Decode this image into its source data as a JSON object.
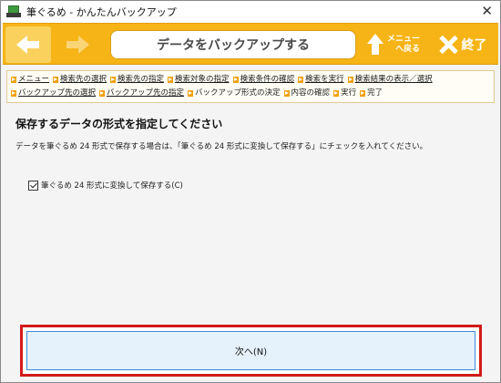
{
  "window": {
    "title": "筆ぐるめ - かんたんバックアップ"
  },
  "toolbar": {
    "page_title": "データをバックアップする",
    "menu_label_line1": "メニュー",
    "menu_label_line2": "へ戻る",
    "end_label": "終了"
  },
  "breadcrumb": [
    {
      "label": "メニュー",
      "link": true
    },
    {
      "label": "検索先の選択",
      "link": true
    },
    {
      "label": "検索先の指定",
      "link": true
    },
    {
      "label": "検索対象の指定",
      "link": true
    },
    {
      "label": "検索条件の確認",
      "link": true
    },
    {
      "label": "検索を実行",
      "link": true
    },
    {
      "label": "検索結果の表示／選択",
      "link": true
    },
    {
      "label": "バックアップ先の選択",
      "link": true
    },
    {
      "label": "バックアップ先の指定",
      "link": true
    },
    {
      "label": "バックアップ形式の決定",
      "link": false
    },
    {
      "label": "内容の確認",
      "link": false
    },
    {
      "label": "実行",
      "link": false
    },
    {
      "label": "完了",
      "link": false
    }
  ],
  "main": {
    "heading": "保存するデータの形式を指定してください",
    "description": "データを筆ぐるめ 24 形式で保存する場合は、「筆ぐるめ 24 形式に変換して保存する」にチェックを入れてください。",
    "option_label": "筆ぐるめ 24 形式に変換して保存する(C)",
    "option_checked": true
  },
  "footer": {
    "next_label": "次へ(N)"
  },
  "colors": {
    "toolbar": "#f6b416",
    "highlight_frame": "#d21a1a",
    "button_bg": "#e5f1fb"
  }
}
